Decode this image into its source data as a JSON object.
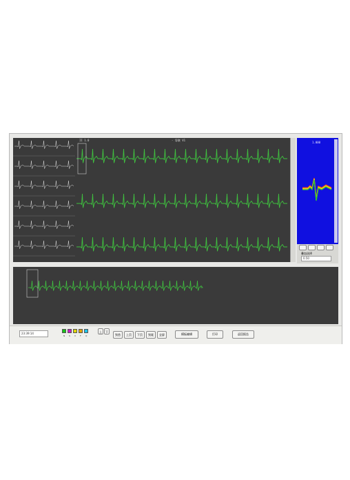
{
  "main_header": {
    "left_label": "II 1.0",
    "center_label": "- 导联 V1"
  },
  "side_panel": {
    "scale_label": "1.000",
    "dropdown_label": "叠加选择",
    "dropdown_value": "0.50"
  },
  "status": {
    "time": "23:39:14"
  },
  "toolbar": {
    "swatches": [
      {
        "color": "#19c219",
        "icon": "green-swatch"
      },
      {
        "color": "#c919c9",
        "icon": "magenta-swatch"
      },
      {
        "color": "#e0d500",
        "icon": "yellow-swatch"
      },
      {
        "color": "#e4a500",
        "icon": "orange-swatch"
      },
      {
        "color": "#20c3e8",
        "icon": "cyan-swatch"
      }
    ],
    "swatch_captions": [
      "N",
      "S",
      "V",
      "F",
      "Q"
    ],
    "small_buttons": [
      "上",
      "下"
    ],
    "nav_buttons": [
      "到首",
      "上页",
      "下页",
      "到尾",
      "全屏"
    ],
    "action_buttons": [
      "模板编辑",
      "打印",
      "返回报告"
    ]
  },
  "trace_color": "#3fc03f"
}
